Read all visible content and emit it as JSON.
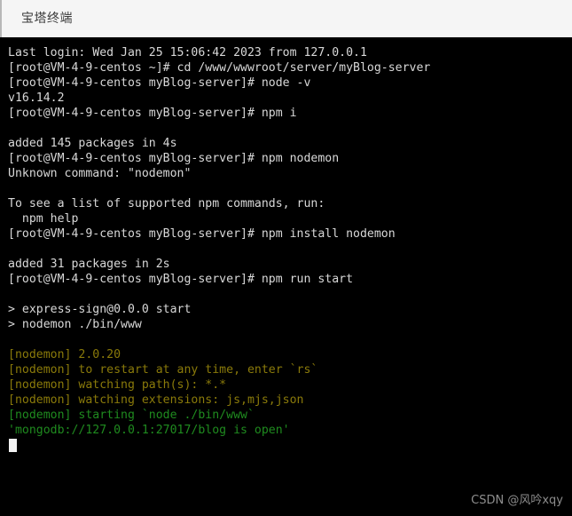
{
  "window": {
    "title": "宝塔终端",
    "background_color": "#000000",
    "titlebar_color": "#f5f5f5"
  },
  "colors": {
    "text_default": "#d8d8d8",
    "green": "#1f8b1f",
    "olive": "#8a7a0a",
    "cursor": "#f2f2f2",
    "watermark": "#8d8d8d"
  },
  "terminal": {
    "lines": [
      {
        "text": "Last login: Wed Jan 25 15:06:42 2023 from 127.0.0.1",
        "color": "white"
      },
      {
        "text": "[root@VM-4-9-centos ~]# cd /www/wwwroot/server/myBlog-server",
        "color": "white"
      },
      {
        "text": "[root@VM-4-9-centos myBlog-server]# node -v",
        "color": "white"
      },
      {
        "text": "v16.14.2",
        "color": "white"
      },
      {
        "text": "[root@VM-4-9-centos myBlog-server]# npm i",
        "color": "white"
      },
      {
        "text": "",
        "color": "white"
      },
      {
        "text": "added 145 packages in 4s",
        "color": "white"
      },
      {
        "text": "[root@VM-4-9-centos myBlog-server]# npm nodemon",
        "color": "white"
      },
      {
        "text": "Unknown command: \"nodemon\"",
        "color": "white"
      },
      {
        "text": "",
        "color": "white"
      },
      {
        "text": "To see a list of supported npm commands, run:",
        "color": "white"
      },
      {
        "text": "  npm help",
        "color": "white"
      },
      {
        "text": "[root@VM-4-9-centos myBlog-server]# npm install nodemon",
        "color": "white"
      },
      {
        "text": "",
        "color": "white"
      },
      {
        "text": "added 31 packages in 2s",
        "color": "white"
      },
      {
        "text": "[root@VM-4-9-centos myBlog-server]# npm run start",
        "color": "white"
      },
      {
        "text": "",
        "color": "white"
      },
      {
        "text": "> express-sign@0.0.0 start",
        "color": "white"
      },
      {
        "text": "> nodemon ./bin/www",
        "color": "white"
      },
      {
        "text": "",
        "color": "white"
      },
      {
        "text": "[nodemon] 2.0.20",
        "color": "olive"
      },
      {
        "text": "[nodemon] to restart at any time, enter `rs`",
        "color": "olive"
      },
      {
        "text": "[nodemon] watching path(s): *.*",
        "color": "olive"
      },
      {
        "text": "[nodemon] watching extensions: js,mjs,json",
        "color": "olive"
      },
      {
        "text": "[nodemon] starting `node ./bin/www`",
        "color": "green"
      },
      {
        "text": "'mongodb://127.0.0.1:27017/blog is open'",
        "color": "green"
      }
    ]
  },
  "watermark": {
    "text": "CSDN @风吟xqy"
  }
}
